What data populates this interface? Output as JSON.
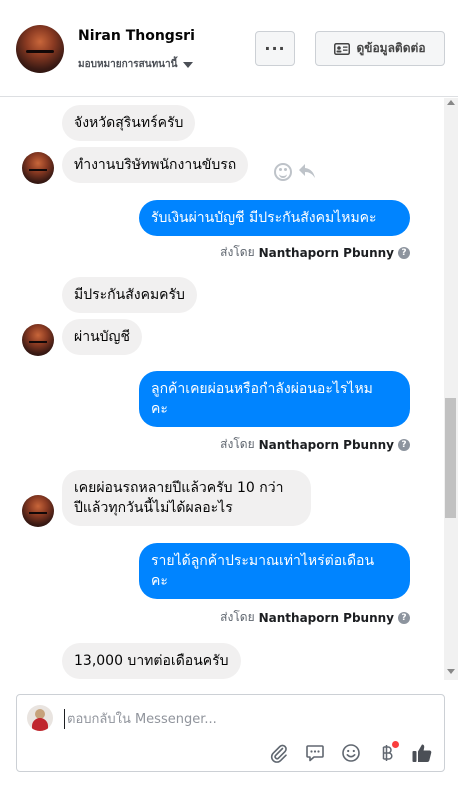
{
  "header": {
    "name": "Niran Thongsri",
    "subtitle": "มอบหมายการสนทนานี้",
    "more_label": "···",
    "contact_label": "ดูข้อมูลติดต่อ"
  },
  "messages": [
    {
      "dir": "in",
      "text": "จังหวัดสุรินทร์ครับ"
    },
    {
      "dir": "in",
      "text": "ทำงานบริษัทพนักงานขับรถ"
    },
    {
      "dir": "out",
      "text": "รับเงินผ่านบัญชี มีประกันสังคมไหมคะ"
    },
    {
      "dir": "in",
      "text": "มีประกันสังคมครับ"
    },
    {
      "dir": "in",
      "text": "ผ่านบัญชี"
    },
    {
      "dir": "out",
      "line1": "ลูกค้าเคยผ่อนหรือกำลังผ่อนอะไรไหม",
      "line2": "คะ"
    },
    {
      "dir": "in",
      "line1": "เคยผ่อนรถหลายปีแล้วครับ 10 กว่า",
      "line2": "ปีแล้วทุกวันนี้ไม่ได้ผลอะไร"
    },
    {
      "dir": "out",
      "line1": "รายได้ลูกค้าประมาณเท่าไหร่ต่อเดือน",
      "line2": "คะ"
    },
    {
      "dir": "in",
      "text": "13,000 บาทต่อเดือนครับ"
    }
  ],
  "sent_by": {
    "prefix": "ส่งโดย",
    "agent": "Nanthaporn Pbunny",
    "help": "?"
  },
  "composer": {
    "placeholder": "ตอบกลับใน Messenger..."
  },
  "colors": {
    "accent": "#0084ff",
    "incoming_bubble": "#f1f0f0",
    "notification_dot": "#fa3e3e"
  },
  "icons": [
    "kebab-more-icon",
    "contact-card-icon",
    "smiley-react-icon",
    "reply-arrow-icon",
    "paperclip-icon",
    "chat-bubble-icon",
    "emoji-icon",
    "baht-payment-icon",
    "thumbs-up-icon",
    "help-circle-icon"
  ]
}
